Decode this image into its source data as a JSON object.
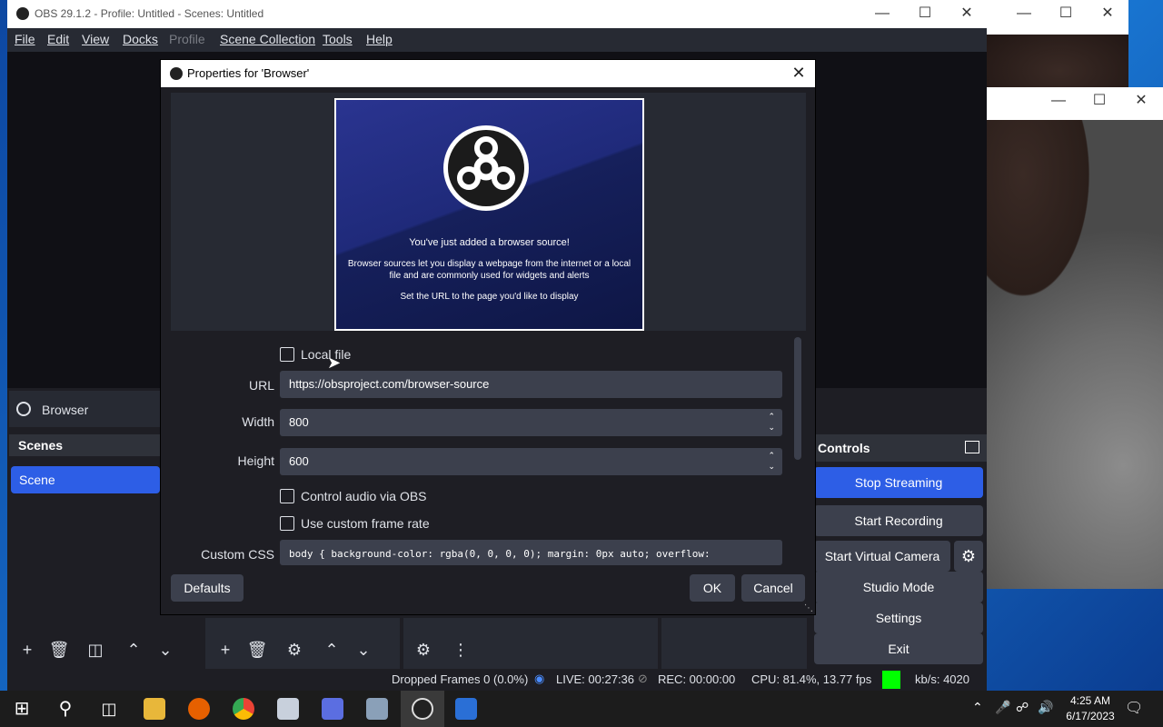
{
  "obs": {
    "title": "OBS 29.1.2 - Profile: Untitled - Scenes: Untitled",
    "menu": [
      "File",
      "Edit",
      "View",
      "Docks",
      "Profile",
      "Scene Collection",
      "Tools",
      "Help"
    ],
    "source_name": "Browser",
    "scenes_header": "Scenes",
    "scene_item": "Scene",
    "controls_header": "Controls",
    "controls": {
      "stop_streaming": "Stop Streaming",
      "start_recording": "Start Recording",
      "start_virtual_camera": "Start Virtual Camera",
      "studio_mode": "Studio Mode",
      "settings": "Settings",
      "exit": "Exit"
    },
    "status": {
      "dropped_frames": "Dropped Frames 0 (0.0%)",
      "live": "LIVE: 00:27:36",
      "rec": "REC: 00:00:00",
      "cpu": "CPU: 81.4%, 13.77 fps",
      "kbs": "kb/s: 4020",
      "health_color": "#00ff00"
    }
  },
  "dialog": {
    "title": "Properties for 'Browser'",
    "preview": {
      "line1": "You've just added a browser source!",
      "line2": "Browser sources let you display a webpage from the internet or a local file and are commonly used for widgets and alerts",
      "line3": "Set the URL to the page you'd like to display"
    },
    "local_file_label": "Local file",
    "url_label": "URL",
    "url_value": "https://obsproject.com/browser-source",
    "width_label": "Width",
    "width_value": "800",
    "height_label": "Height",
    "height_value": "600",
    "control_audio_label": "Control audio via OBS",
    "custom_frame_rate_label": "Use custom frame rate",
    "custom_css_label": "Custom CSS",
    "custom_css_value": "body { background-color: rgba(0, 0, 0, 0); margin: 0px auto; overflow:",
    "defaults_label": "Defaults",
    "ok_label": "OK",
    "cancel_label": "Cancel"
  },
  "taskbar": {
    "time": "4:25 AM",
    "date": "6/17/2023"
  },
  "colors": {
    "accent": "#2d5ee6",
    "panel": "#272a33",
    "background": "#1e1e24"
  }
}
